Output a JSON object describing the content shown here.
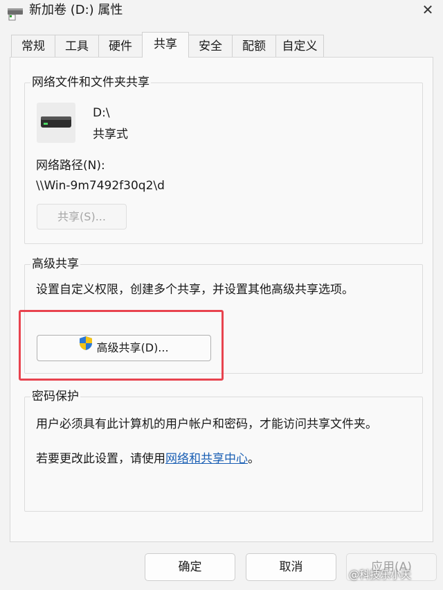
{
  "window": {
    "title": "新加卷 (D:) 属性",
    "close_label": "✕"
  },
  "tabs": [
    {
      "label": "常规"
    },
    {
      "label": "工具"
    },
    {
      "label": "硬件"
    },
    {
      "label": "共享",
      "active": true
    },
    {
      "label": "安全"
    },
    {
      "label": "配额"
    },
    {
      "label": "自定义"
    }
  ],
  "network_share": {
    "group_label": "网络文件和文件夹共享",
    "drive_name": "D:\\",
    "share_status": "共享式",
    "path_label": "网络路径(N):",
    "path_value": "\\\\Win-9m7492f30q2\\d",
    "share_button": "共享(S)..."
  },
  "advanced_share": {
    "group_label": "高级共享",
    "description": "设置自定义权限，创建多个共享，并设置其他高级共享选项。",
    "button_label": "高级共享(D)..."
  },
  "password_protection": {
    "group_label": "密码保护",
    "line1": "用户必须具有此计算机的用户帐户和密码，才能访问共享文件夹。",
    "line2_prefix": "若要更改此设置，请使用",
    "line2_link": "网络和共享中心",
    "line2_suffix": "。"
  },
  "footer": {
    "ok": "确定",
    "cancel": "取消",
    "apply": "应用(A)"
  },
  "watermark": "@科技乐小天",
  "colors": {
    "highlight_box": "#e8434e",
    "link": "#1a5fb4",
    "shield_blue": "#2b78d4",
    "shield_yellow": "#f3c316"
  }
}
